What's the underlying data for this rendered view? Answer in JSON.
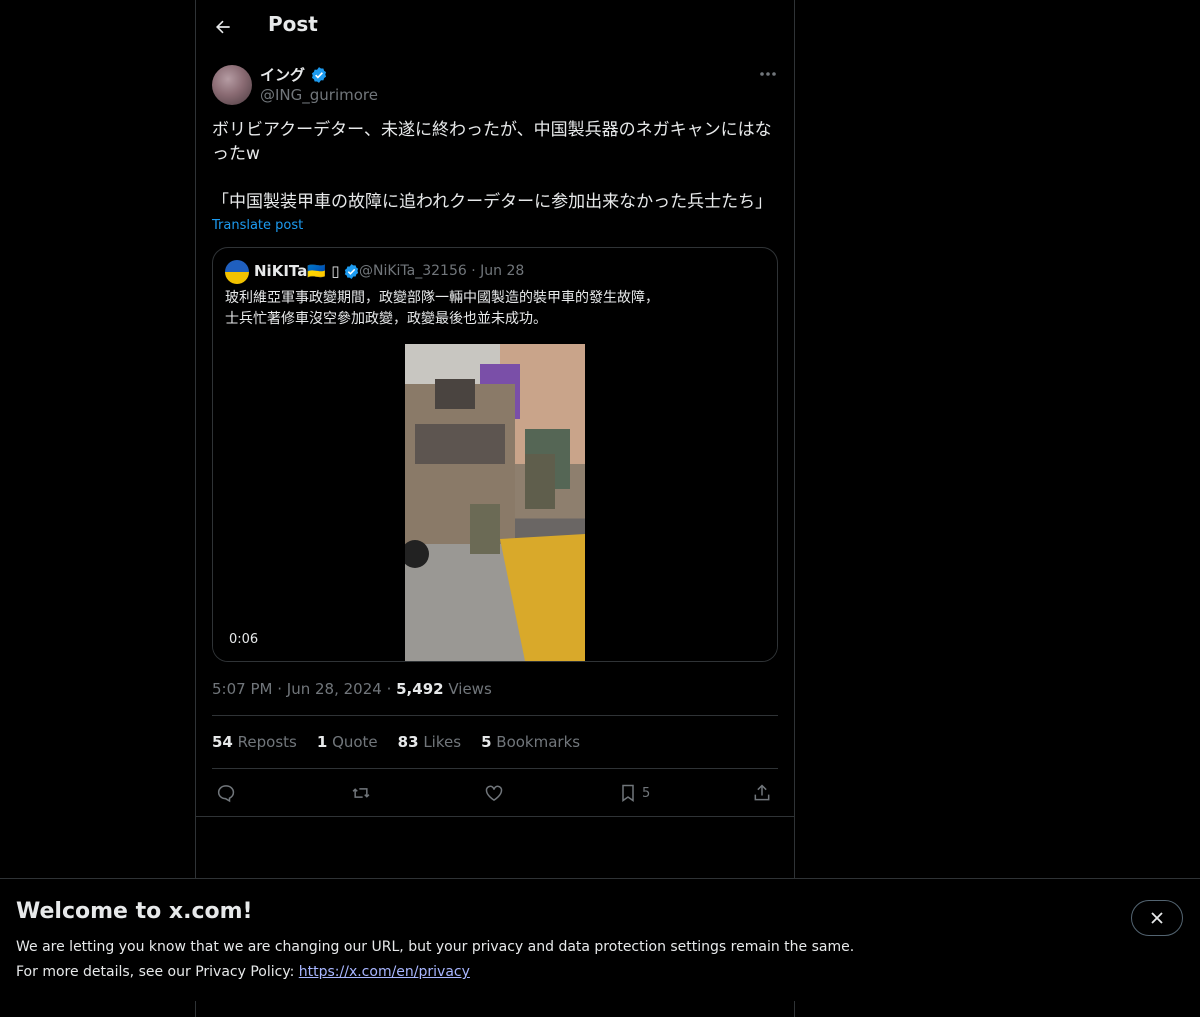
{
  "header": {
    "title": "Post"
  },
  "post": {
    "author_name": "イング",
    "author_handle": "@ING_gurimore",
    "text": "ボリビアクーデター、未遂に終わったが、中国製兵器のネガキャンにはなったw\n\n「中国製装甲車の故障に追われクーデターに参加出来なかった兵士たち」",
    "translate_label": "Translate post",
    "time": "5:07 PM",
    "date": "Jun 28, 2024",
    "views_count": "5,492",
    "views_label": "Views"
  },
  "quote": {
    "author_name": "NiKITa🇺🇦 ▯",
    "author_handle": "@NiKiTa_32156",
    "date": "Jun 28",
    "text": "玻利維亞軍事政變期間，政變部隊一輛中國製造的裝甲車的發生故障，\n士兵忙著修車沒空參加政變，政變最後也並未成功。",
    "video_duration": "0:06"
  },
  "stats": [
    {
      "count": "54",
      "label": "Reposts"
    },
    {
      "count": "1",
      "label": "Quote"
    },
    {
      "count": "83",
      "label": "Likes"
    },
    {
      "count": "5",
      "label": "Bookmarks"
    }
  ],
  "actions": {
    "bookmark_count": "5"
  },
  "banner": {
    "title": "Welcome to x.com!",
    "line1": "We are letting you know that we are changing our URL, but your privacy and data protection settings remain the same.",
    "line2_prefix": "For more details, see our Privacy Policy: ",
    "link": "https://x.com/en/privacy"
  },
  "colors": {
    "background": "#000000",
    "accent": "#1d9bf0",
    "border": "#2f3336",
    "muted": "#71767b"
  }
}
